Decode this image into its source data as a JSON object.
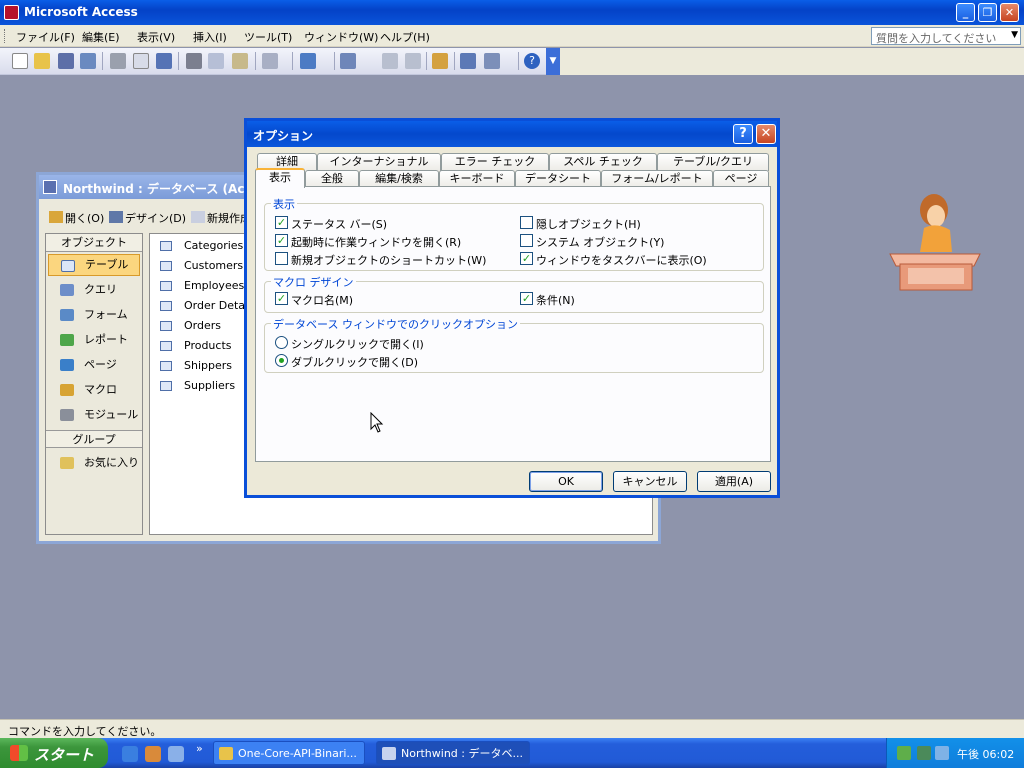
{
  "app": {
    "title": "Microsoft Access"
  },
  "menu": [
    {
      "label": "ファイル(F)"
    },
    {
      "label": "編集(E)"
    },
    {
      "label": "表示(V)"
    },
    {
      "label": "挿入(I)"
    },
    {
      "label": "ツール(T)"
    },
    {
      "label": "ウィンドウ(W)"
    },
    {
      "label": "ヘルプ(H)"
    }
  ],
  "help_search": {
    "placeholder": "質問を入力してください"
  },
  "db_window": {
    "title": "Northwind : データベース (Access 2000 ファイル形式)",
    "toolbar": {
      "open": "開く(O)",
      "design": "デザイン(D)",
      "new": "新規作成(N)"
    },
    "objects_header": "オブジェクト",
    "objects": [
      {
        "label": "テーブル"
      },
      {
        "label": "クエリ"
      },
      {
        "label": "フォーム"
      },
      {
        "label": "レポート"
      },
      {
        "label": "ページ"
      },
      {
        "label": "マクロ"
      },
      {
        "label": "モジュール"
      }
    ],
    "groups_header": "グループ",
    "groups": [
      {
        "label": "お気に入り"
      }
    ],
    "tables": [
      "Categories",
      "Customers",
      "Employees",
      "Order Details",
      "Orders",
      "Products",
      "Shippers",
      "Suppliers"
    ]
  },
  "options_dialog": {
    "title": "オプション",
    "help_label": "?",
    "tabs_row1": [
      "詳細",
      "インターナショナル",
      "エラー チェック",
      "スペル チェック",
      "テーブル/クエリ"
    ],
    "tabs_row2": [
      "表示",
      "全般",
      "編集/検索",
      "キーボード",
      "データシート",
      "フォーム/レポート",
      "ページ"
    ],
    "active_tab": "表示",
    "group_display": {
      "label": "表示",
      "items": [
        {
          "label": "ステータス バー(S)",
          "checked": true
        },
        {
          "label": "起動時に作業ウィンドウを開く(R)",
          "checked": true
        },
        {
          "label": "新規オブジェクトのショートカット(W)",
          "checked": false
        },
        {
          "label": "隠しオブジェクト(H)",
          "checked": false
        },
        {
          "label": "システム オブジェクト(Y)",
          "checked": false
        },
        {
          "label": "ウィンドウをタスクバーに表示(O)",
          "checked": true
        }
      ]
    },
    "group_macro": {
      "label": "マクロ デザイン",
      "items": [
        {
          "label": "マクロ名(M)",
          "checked": true
        },
        {
          "label": "条件(N)",
          "checked": true
        }
      ]
    },
    "group_click": {
      "label": "データベース ウィンドウでのクリックオプション",
      "items": [
        {
          "label": "シングルクリックで開く(I)",
          "selected": false
        },
        {
          "label": "ダブルクリックで開く(D)",
          "selected": true
        }
      ]
    },
    "buttons": {
      "ok": "OK",
      "cancel": "キャンセル",
      "apply": "適用(A)"
    }
  },
  "status_bar": {
    "text": "コマンドを入力してください。"
  },
  "taskbar": {
    "start": "スタート",
    "items": [
      {
        "label": "One-Core-API-Binari..."
      },
      {
        "label": "Northwind : データベ..."
      }
    ],
    "clock": "午後 06:02"
  },
  "colors": {
    "xp_blue": "#0a5ee8",
    "selected_object": "#fbd67f",
    "group_label": "#0046d5"
  }
}
